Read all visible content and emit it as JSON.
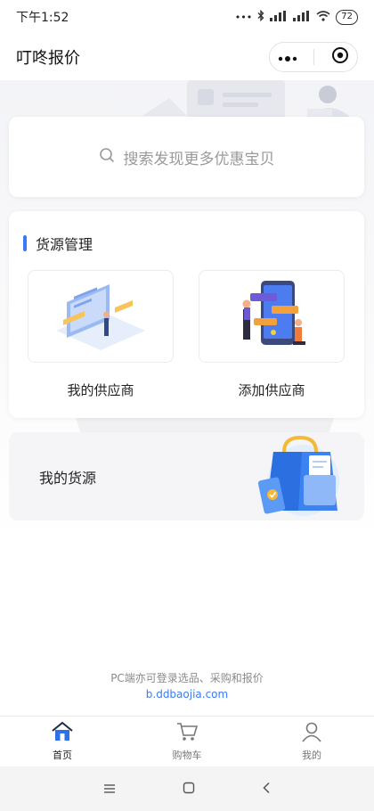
{
  "status_bar": {
    "time": "下午1:52",
    "signal": "HD",
    "battery": "72"
  },
  "nav": {
    "title": "叮咚报价"
  },
  "search": {
    "placeholder": "搜索发现更多优惠宝贝"
  },
  "supply": {
    "heading": "货源管理",
    "tiles": [
      {
        "label": "我的供应商"
      },
      {
        "label": "添加供应商"
      }
    ]
  },
  "my_source": {
    "label": "我的货源"
  },
  "footer": {
    "note": "PC端亦可登录选品、采购和报价",
    "link": "b.ddbaojia.com"
  },
  "tabbar": {
    "tabs": [
      {
        "label": "首页",
        "icon": "home-icon",
        "active": true
      },
      {
        "label": "购物车",
        "icon": "cart-icon",
        "active": false
      },
      {
        "label": "我的",
        "icon": "user-icon",
        "active": false
      }
    ]
  },
  "colors": {
    "accent": "#3a7bf5",
    "active_tab_icon": "#2f6fe8"
  }
}
